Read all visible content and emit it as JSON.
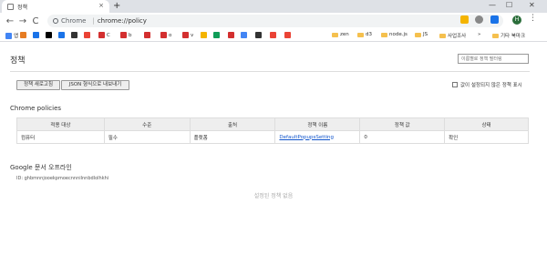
{
  "tab": {
    "title": "정책",
    "close": "×",
    "new_tab": "+"
  },
  "window": {
    "minimize": "—",
    "maximize": "☐",
    "close": "✕"
  },
  "toolbar": {
    "back": "←",
    "forward": "→",
    "reload": "C",
    "secure_label": "Chrome",
    "separator": "|",
    "url": "chrome://policy",
    "star": "☆",
    "avatar_letter": "H",
    "menu": "⋮"
  },
  "bookmarks": {
    "apps": "앱",
    "items": [
      {
        "label": "",
        "color": "#e67c22"
      },
      {
        "label": "",
        "color": "#1a73e8"
      },
      {
        "label": "",
        "color": "#000000"
      },
      {
        "label": "",
        "color": "#1a73e8"
      },
      {
        "label": "",
        "color": "#333333"
      },
      {
        "label": "",
        "color": "#ea4335"
      },
      {
        "label": "C",
        "color": "#d32f2f"
      },
      {
        "label": "b",
        "color": "#d32f2f"
      },
      {
        "label": "",
        "color": "#d32f2f"
      },
      {
        "label": "o",
        "color": "#d32f2f"
      },
      {
        "label": "v",
        "color": "#d32f2f"
      },
      {
        "label": "",
        "color": "#f4b400"
      },
      {
        "label": "",
        "color": "#0f9d58"
      },
      {
        "label": "",
        "color": "#d32f2f"
      },
      {
        "label": "",
        "color": "#4285f4"
      },
      {
        "label": "",
        "color": "#333333"
      },
      {
        "label": "",
        "color": "#ea4335"
      },
      {
        "label": "",
        "color": "#ea4335"
      }
    ],
    "folders": [
      "zen",
      "d3",
      "node.js",
      "JS",
      "사업조사"
    ],
    "more": "»",
    "other": "기타 북마크"
  },
  "page": {
    "title": "정책",
    "filter_placeholder": "이름별로 정책 필터링",
    "reload_button": "정책 새로고침",
    "export_button": "JSON 형식으로 내보내기",
    "show_unset_label": "값이 설정되지 않은 정책 표시"
  },
  "chrome_policies": {
    "title": "Chrome policies",
    "headers": [
      "적용 대상",
      "수준",
      "출처",
      "정책 이름",
      "정책 값",
      "상태"
    ],
    "rows": [
      {
        "scope": "컴퓨터",
        "level": "필수",
        "source": "플랫폼",
        "name": "DefaultPopupsSetting",
        "value": "0",
        "status": "확인"
      }
    ]
  },
  "extension": {
    "title": "Google 문서 오프라인",
    "id_label": "ID: ghbmnnjooekpmoecnnnilnnbdlolhkhi",
    "no_policy": "설정된 정책 없음"
  }
}
